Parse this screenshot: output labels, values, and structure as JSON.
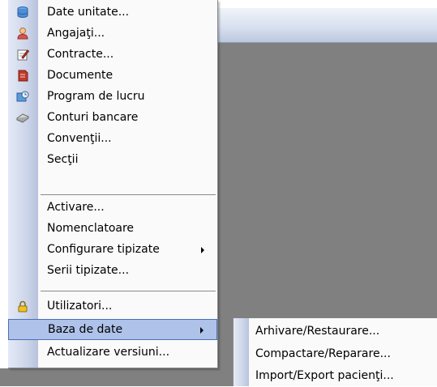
{
  "menu": {
    "items": [
      {
        "label": "Date unitate...",
        "icon": "database-icon"
      },
      {
        "label": "Angajaţi...",
        "icon": "user-icon"
      },
      {
        "label": "Contracte...",
        "icon": "contract-icon"
      },
      {
        "label": "Documente",
        "icon": "documents-icon"
      },
      {
        "label": "Program de lucru",
        "icon": "schedule-icon"
      },
      {
        "label": "Conturi bancare",
        "icon": "bank-card-icon"
      },
      {
        "label": "Convenţii..."
      },
      {
        "label": "Secţii"
      },
      {
        "label": "Activare..."
      },
      {
        "label": "Nomenclatoare"
      },
      {
        "label": "Configurare tipizate",
        "submenu": true
      },
      {
        "label": "Serii tipizate..."
      },
      {
        "label": "Utilizatori...",
        "icon": "lock-icon"
      },
      {
        "label": "Baza de date",
        "submenu": true,
        "selected": true
      },
      {
        "label": "Actualizare versiuni..."
      }
    ]
  },
  "submenu": {
    "items": [
      {
        "label": "Arhivare/Restaurare..."
      },
      {
        "label": "Compactare/Reparare..."
      },
      {
        "label": "Import/Export pacienţi..."
      }
    ]
  },
  "colors": {
    "highlight": "#aec2ea",
    "highlight_border": "#4b6fb4",
    "workspace": "#808080"
  }
}
